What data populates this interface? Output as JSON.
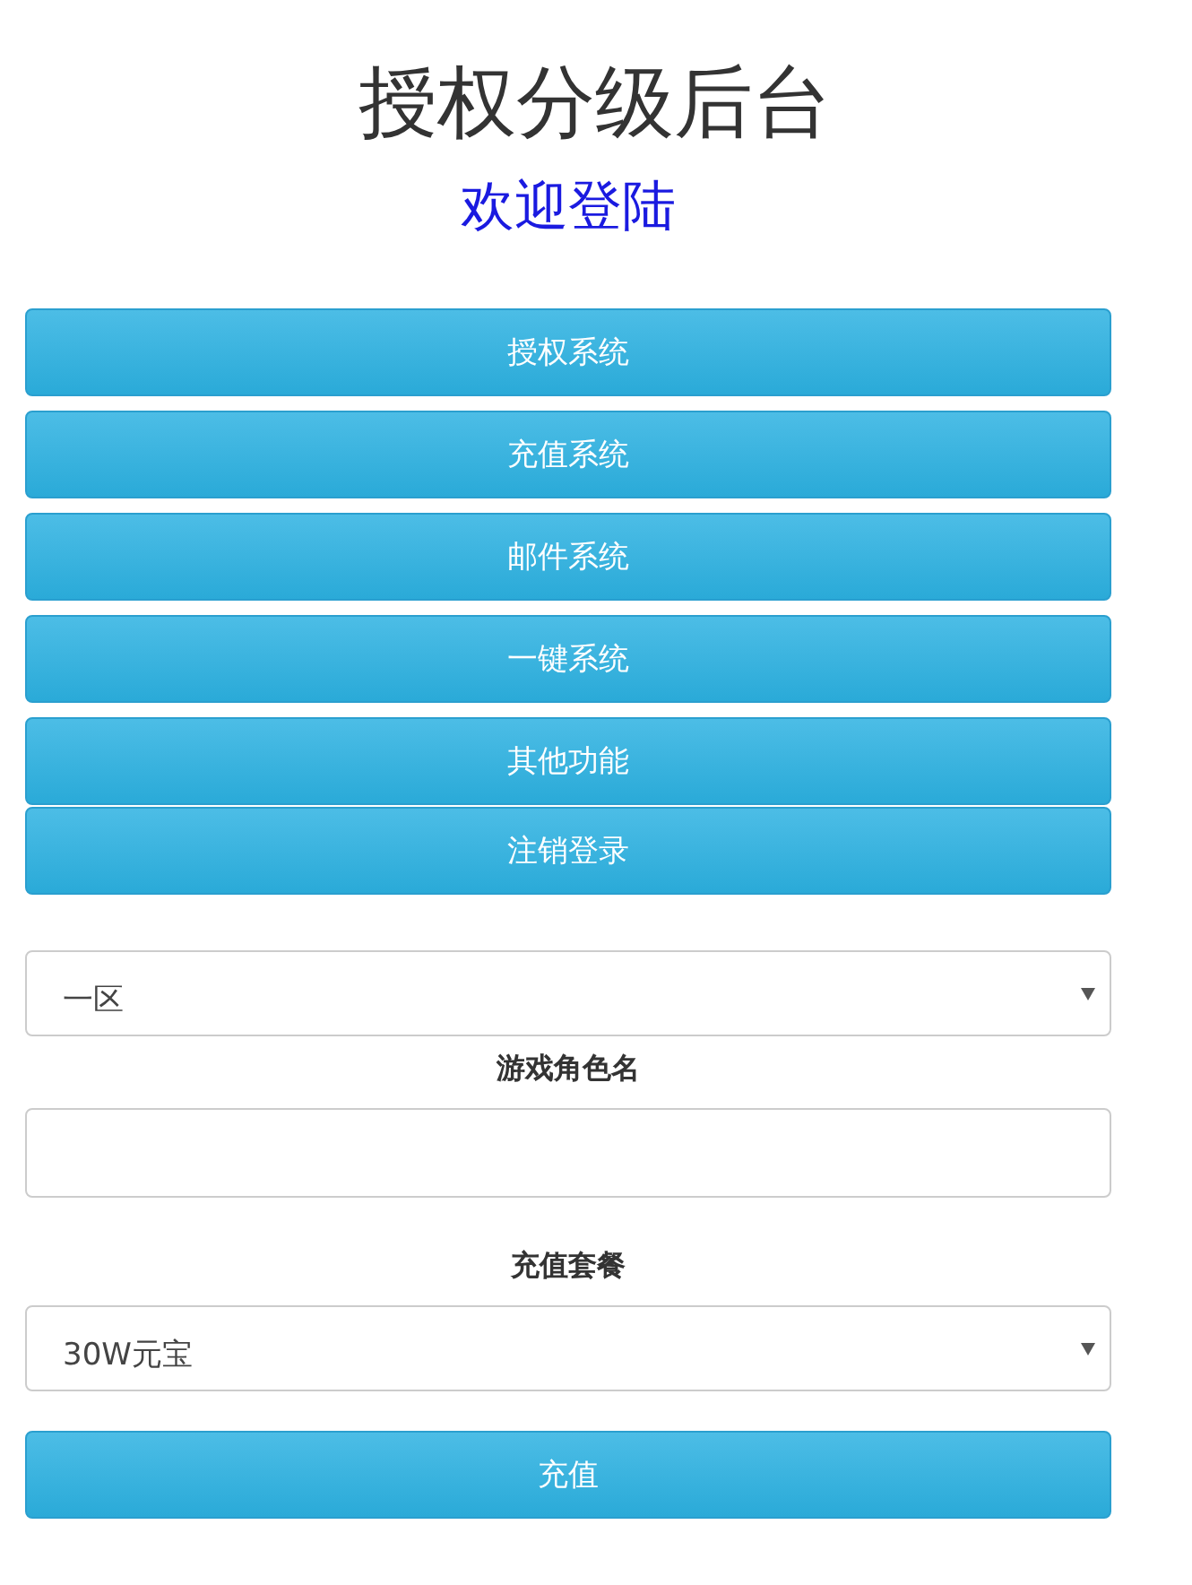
{
  "title": "授权分级后台",
  "subtitle": "欢迎登陆",
  "menu_buttons": [
    {
      "label": "授权系统"
    },
    {
      "label": "充值系统"
    },
    {
      "label": "邮件系统"
    },
    {
      "label": "一键系统"
    },
    {
      "label": "其他功能"
    },
    {
      "label": "注销登录"
    }
  ],
  "form": {
    "zone_select": {
      "value": "一区"
    },
    "role_label": "游戏角色名",
    "package_label": "充值套餐",
    "package_select": {
      "value": "30W元宝"
    },
    "submit_button": "充值"
  }
}
